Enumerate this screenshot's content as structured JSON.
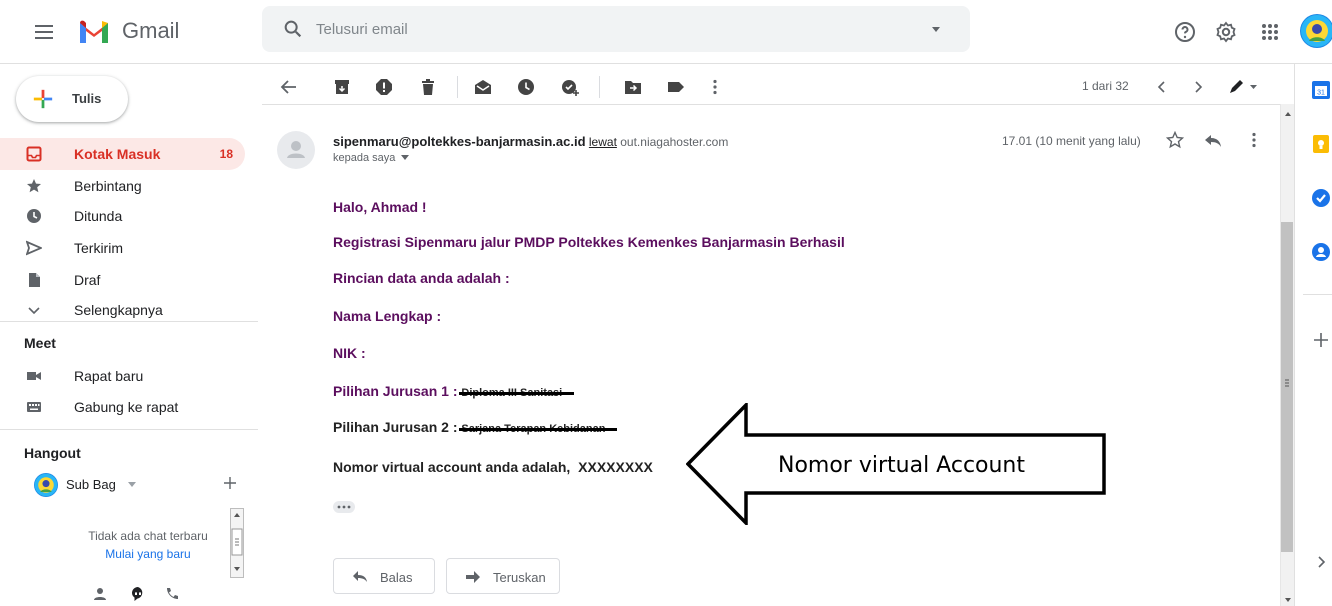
{
  "header": {
    "product_name": "Gmail",
    "search_placeholder": "Telusuri email"
  },
  "compose": {
    "label": "Tulis"
  },
  "nav": {
    "items": [
      {
        "label": "Kotak Masuk",
        "count": "18",
        "icon": "inbox-icon",
        "active": true
      },
      {
        "label": "Berbintang",
        "icon": "star-icon"
      },
      {
        "label": "Ditunda",
        "icon": "clock-icon"
      },
      {
        "label": "Terkirim",
        "icon": "send-icon"
      },
      {
        "label": "Draf",
        "icon": "file-icon"
      },
      {
        "label": "Selengkapnya",
        "icon": "chevron-down-icon"
      }
    ]
  },
  "meet": {
    "title": "Meet",
    "items": [
      {
        "label": "Rapat baru",
        "icon": "video-icon"
      },
      {
        "label": "Gabung ke rapat",
        "icon": "keyboard-icon"
      }
    ]
  },
  "hangout": {
    "title": "Hangout",
    "user_name": "Sub Bag",
    "no_chat_text": "Tidak ada chat terbaru",
    "start_new_link": "Mulai yang baru"
  },
  "toolbar": {
    "pager": "1 dari 32"
  },
  "message": {
    "sender_email": "sipenmaru@poltekkes-banjarmasin.ac.id",
    "via_label": "lewat",
    "via_domain": "out.niagahoster.com",
    "to_line": "kepada saya",
    "time": "17.01 (10 menit yang lalu)",
    "body": {
      "greeting": "Halo, Ahmad !",
      "line1": "Registrasi Sipenmaru jalur PMDP Poltekkes Kemenkes Banjarmasin Berhasil",
      "line2": "Rincian data anda adalah :",
      "line3": "Nama Lengkap :",
      "line4": "NIK :",
      "line5_label": "Pilihan Jurusan 1 :",
      "line5_value": "Diploma III Sanitasi",
      "line6_label": "Pilihan Jurusan 2 :",
      "line6_value": "Sarjana Terapan Kebidanan",
      "line7_label": "Nomor virtual account anda adalah,",
      "line7_value": "XXXXXXXX"
    },
    "reply_label": "Balas",
    "forward_label": "Teruskan"
  },
  "annotation": {
    "text": "Nomor virtual Account"
  }
}
